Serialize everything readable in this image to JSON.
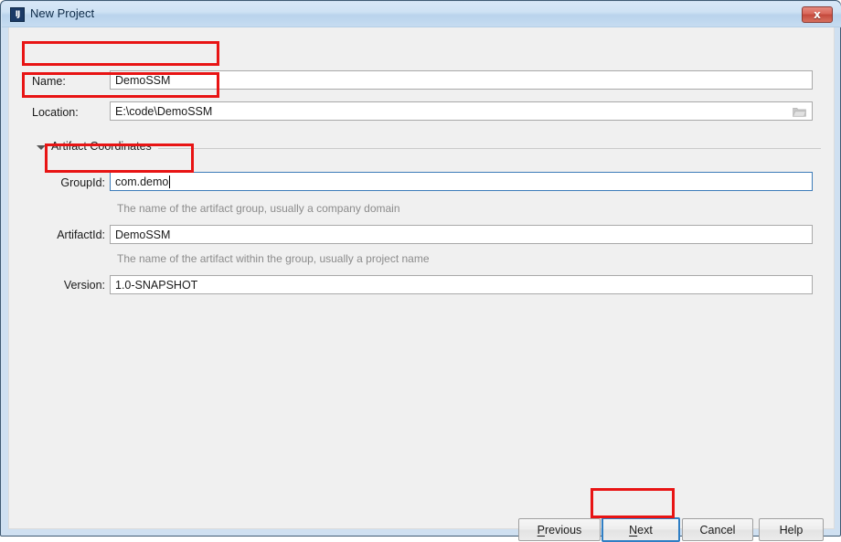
{
  "window": {
    "title": "New Project",
    "app_icon": "intellij-idea-icon",
    "icon_glyph": "IJ",
    "close_label": "✖",
    "close_glyph": "x"
  },
  "form": {
    "name": {
      "label": "Name:",
      "value": "DemoSSM",
      "placeholder": ""
    },
    "location": {
      "label": "Location:",
      "value": "E:\\code\\DemoSSM",
      "placeholder": "",
      "browse_icon": "folder-icon"
    }
  },
  "section": {
    "label": "Artifact Coordinates",
    "expanded": true,
    "toggle_icon": "chevron-down-icon",
    "fields": [
      {
        "key": "groupid",
        "label": "GroupId:",
        "value": "com.demo",
        "helper": "The name of the artifact group, usually a company domain",
        "focused": true
      },
      {
        "key": "artifactid",
        "label": "ArtifactId:",
        "value": "DemoSSM",
        "helper": "The name of the artifact within the group, usually a project name",
        "focused": false
      },
      {
        "key": "version",
        "label": "Version:",
        "value": "1.0-SNAPSHOT",
        "helper": "",
        "focused": false
      }
    ]
  },
  "buttons": {
    "previous": {
      "label": "Previous",
      "mnemonic": "P",
      "default": false
    },
    "next": {
      "label": "Next",
      "mnemonic": "N",
      "default": true
    },
    "cancel": {
      "label": "Cancel",
      "mnemonic": "",
      "default": false
    },
    "help": {
      "label": "Help",
      "mnemonic": "",
      "default": false
    }
  },
  "annotations": {
    "color": "#e81414",
    "boxes": [
      "name-field-row",
      "location-field-row",
      "groupid-field-row",
      "next-button"
    ]
  },
  "colors": {
    "accent": "#2f7ec4",
    "annotation": "#e81414",
    "titlebar": "#cfe2f4",
    "client_bg": "#f0f0f0",
    "helper_text": "#8c8c8c"
  }
}
